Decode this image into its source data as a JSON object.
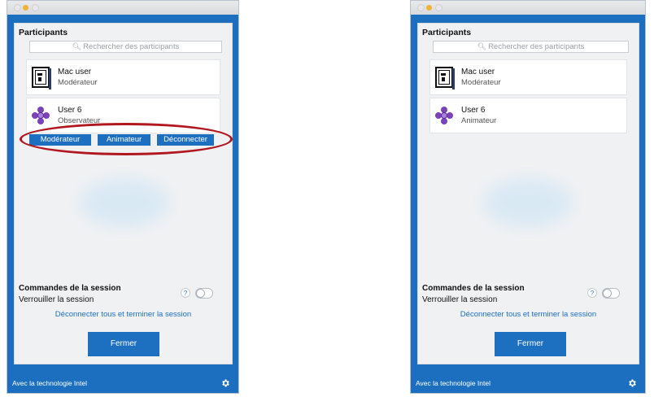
{
  "panels": [
    {
      "title": "Participants",
      "search_placeholder": "Rechercher des participants",
      "participants": [
        {
          "name": "Mac user",
          "role": "Modérateur",
          "avatar": "mac-avatar-icon"
        },
        {
          "name": "User 6",
          "role": "Observateur",
          "avatar": "flower-avatar-icon"
        }
      ],
      "actions": [
        "Modérateur",
        "Animateur",
        "Déconnecter"
      ],
      "session": {
        "title": "Commandes de la session",
        "lock_label": "Verrouiller la session",
        "help": "?",
        "disconnect_all": "Déconnecter tous et terminer la session",
        "close": "Fermer"
      },
      "footer": "Avec la technologie Intel"
    },
    {
      "title": "Participants",
      "search_placeholder": "Rechercher des participants",
      "participants": [
        {
          "name": "Mac user",
          "role": "Modérateur",
          "avatar": "mac-avatar-icon"
        },
        {
          "name": "User 6",
          "role": "Animateur",
          "avatar": "flower-avatar-icon"
        }
      ],
      "session": {
        "title": "Commandes de la session",
        "lock_label": "Verrouiller la session",
        "help": "?",
        "disconnect_all": "Déconnecter tous et terminer la session",
        "close": "Fermer"
      },
      "footer": "Avec la technologie Intel"
    }
  ],
  "colors": {
    "brand_blue": "#1d6fbf",
    "highlight_red": "#b0171f",
    "traffic_yellow": "#f2b233"
  }
}
